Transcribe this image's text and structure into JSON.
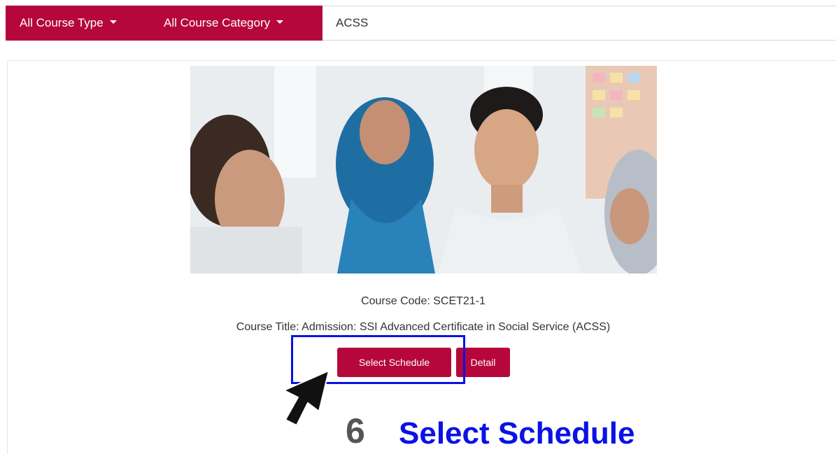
{
  "filters": {
    "course_type": "All Course Type",
    "course_category": "All Course Category",
    "search_value": "ACSS"
  },
  "course": {
    "code_line": "Course Code: SCET21-1",
    "title_line": "Course Title: Admission: SSI Advanced Certificate in Social Service (ACSS)",
    "select_schedule_label": "Select Schedule",
    "detail_label": "Detail"
  },
  "annotation": {
    "step_number": "6",
    "step_label": "Select Schedule"
  },
  "colors": {
    "brand": "#b5073c",
    "annotation_blue": "#0a12e6"
  }
}
